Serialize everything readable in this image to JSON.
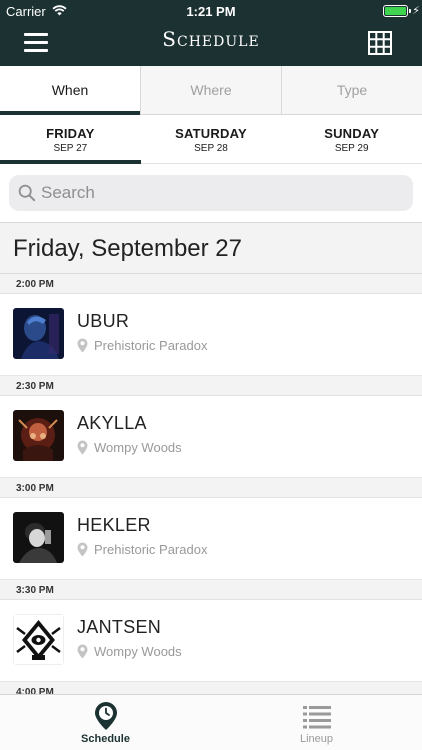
{
  "status_bar": {
    "carrier": "Carrier",
    "time": "1:21 PM"
  },
  "nav": {
    "title": "Schedule",
    "menu_icon": "hamburger-icon",
    "grid_icon": "grid-icon"
  },
  "filter_tabs": [
    {
      "label": "When",
      "selected": true
    },
    {
      "label": "Where",
      "selected": false
    },
    {
      "label": "Type",
      "selected": false
    }
  ],
  "days": [
    {
      "name": "FRIDAY",
      "date": "SEP 27",
      "selected": true
    },
    {
      "name": "SATURDAY",
      "date": "SEP 28",
      "selected": false
    },
    {
      "name": "SUNDAY",
      "date": "SEP 29",
      "selected": false
    }
  ],
  "search": {
    "placeholder": "Search",
    "value": ""
  },
  "day_header": "Friday, September 27",
  "schedule": [
    {
      "time": "2:00 PM",
      "artist": "UBUR",
      "venue": "Prehistoric Paradox"
    },
    {
      "time": "2:30 PM",
      "artist": "AKYLLA",
      "venue": "Wompy Woods"
    },
    {
      "time": "3:00 PM",
      "artist": "HEKLER",
      "venue": "Prehistoric Paradox"
    },
    {
      "time": "3:30 PM",
      "artist": "JANTSEN",
      "venue": "Wompy Woods"
    },
    {
      "time": "4:00 PM"
    }
  ],
  "tab_bar": [
    {
      "label": "Schedule",
      "icon": "clock-pin-icon",
      "active": true
    },
    {
      "label": "Lineup",
      "icon": "list-icon",
      "active": false
    }
  ],
  "colors": {
    "header_bg": "#1c3132",
    "accent": "#1c3132",
    "battery": "#3fd44f"
  }
}
